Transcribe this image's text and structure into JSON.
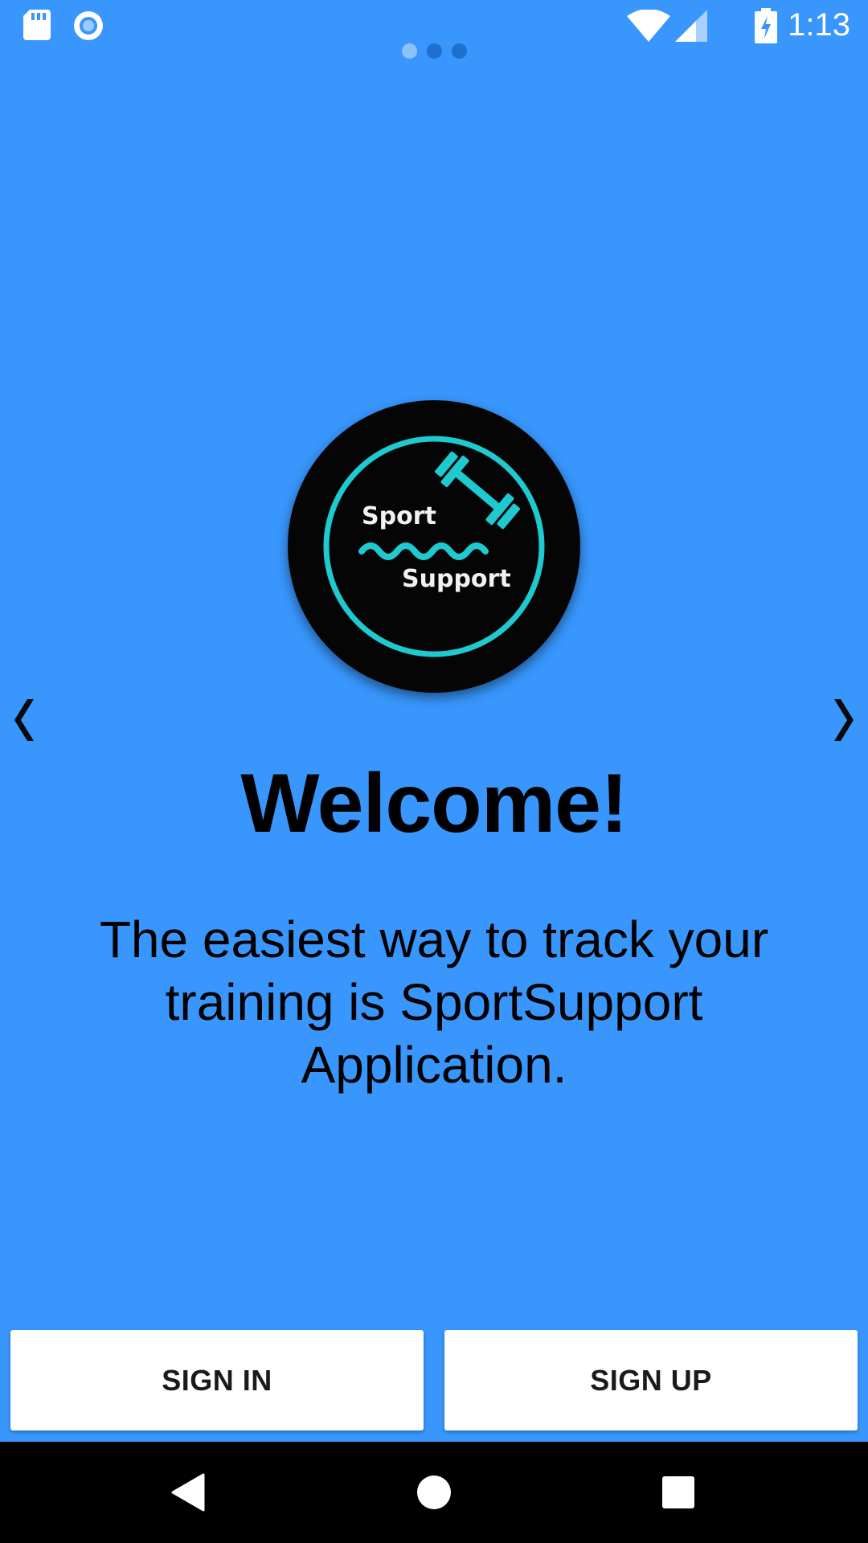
{
  "status_bar": {
    "time": "1:13",
    "left_icons": [
      "sd-card-icon",
      "record-icon"
    ],
    "right_icons": [
      "wifi-icon",
      "signal-icon",
      "battery-charging-icon"
    ]
  },
  "pager": {
    "dots": 3,
    "active_index": 0
  },
  "logo": {
    "text_top": "Sport",
    "text_bottom": "Support",
    "accent_color": "#1EC9D0",
    "icon": "dumbbell-icon"
  },
  "navigation_arrows": {
    "prev": "❮",
    "next": "❯"
  },
  "welcome": {
    "title": "Welcome!",
    "description": "The easiest way to track your training is SportSupport Application."
  },
  "buttons": {
    "sign_in": "SIGN IN",
    "sign_up": "SIGN UP"
  },
  "system_nav": {
    "items": [
      "back-icon",
      "home-icon",
      "recents-icon"
    ]
  },
  "colors": {
    "background": "#3896FC",
    "button_bg": "#FFFFFF",
    "nav_bar": "#000000"
  }
}
